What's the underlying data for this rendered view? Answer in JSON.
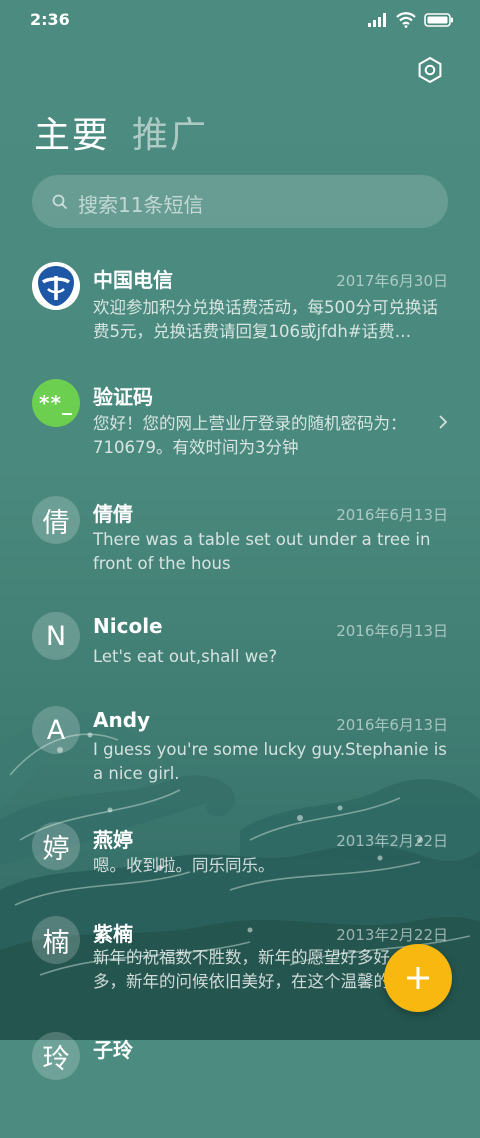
{
  "status_bar": {
    "time": "2:36"
  },
  "tabs": [
    {
      "label": "主要",
      "active": true
    },
    {
      "label": "推广",
      "active": false
    }
  ],
  "search": {
    "placeholder": "搜索11条短信"
  },
  "conversations": [
    {
      "name": "中国电信",
      "date": "2017年6月30日",
      "preview": "欢迎参加积分兑换话费活动，每500分可兑换话费5元，兑换话费请回复106或jfdh#话费…",
      "avatar": "china-telecom-logo-icon"
    },
    {
      "name": "验证码",
      "date": "",
      "preview": "您好！您的网上营业厅登录的随机密码为：710679。有效时间为3分钟",
      "avatar_text": "**_",
      "avatar": "verification-code-icon"
    },
    {
      "name": "倩倩",
      "date": "2016年6月13日",
      "preview": "There was a table set out under a tree in front of the hous",
      "avatar_text": "倩"
    },
    {
      "name": "Nicole",
      "date": "2016年6月13日",
      "preview": "Let's eat out,shall we?",
      "avatar_text": "N"
    },
    {
      "name": "Andy",
      "date": "2016年6月13日",
      "preview": "I guess you're some lucky guy.Stephanie is a nice girl.",
      "avatar_text": "A"
    },
    {
      "name": "燕婷",
      "date": "2013年2月22日",
      "preview": "嗯。收到啦。同乐同乐。",
      "avatar_text": "婷"
    },
    {
      "name": "紫楠",
      "date": "2013年2月22日",
      "preview": "新年的祝福数不胜数，新年的愿望好多好多，新年的问候依旧美好，在这个温馨的时刻",
      "avatar_text": "楠"
    },
    {
      "name": "子玲",
      "date": "",
      "preview": "",
      "avatar_text": "玲"
    }
  ],
  "fab": {
    "icon": "plus-icon",
    "color": "#f9b80f"
  },
  "colors": {
    "background": "#4a897d",
    "accent": "#f9b80f",
    "verification_avatar": "#6ccf4f"
  }
}
